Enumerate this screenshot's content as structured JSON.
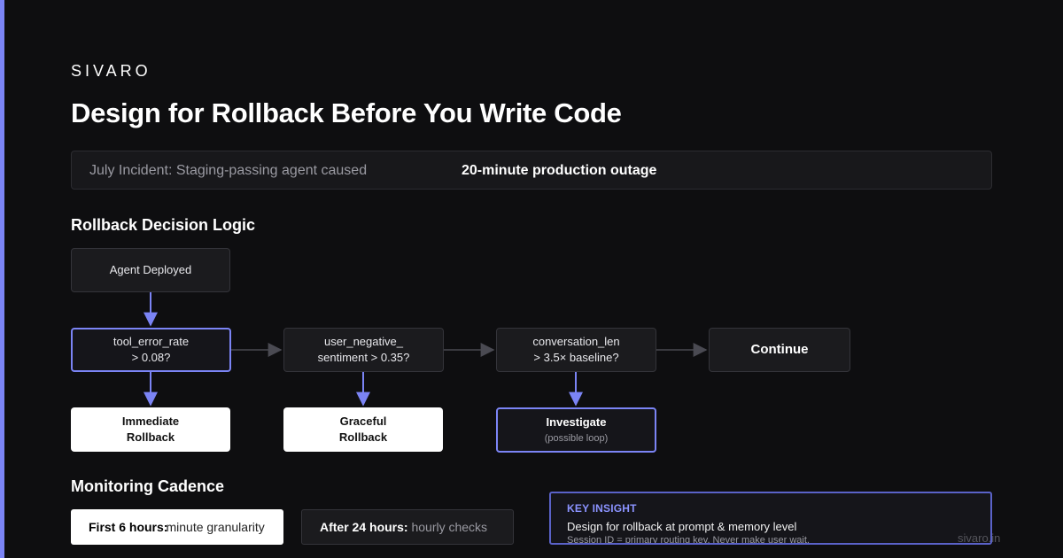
{
  "brand": "SIVARO",
  "title": "Design for Rollback Before You Write Code",
  "incident": {
    "lead": "July Incident: Staging-passing agent caused",
    "stat": "20-minute production outage"
  },
  "decision": {
    "heading": "Rollback Decision Logic",
    "start": "Agent Deployed",
    "checks": [
      {
        "line1": "tool_error_rate",
        "line2": "> 0.08?"
      },
      {
        "line1": "user_negative_",
        "line2": "sentiment > 0.35?"
      },
      {
        "line1": "conversation_len",
        "line2": "> 3.5× baseline?"
      }
    ],
    "continue": "Continue",
    "outcomes": [
      {
        "line1": "Immediate",
        "line2": "Rollback"
      },
      {
        "line1": "Graceful",
        "line2": "Rollback"
      },
      {
        "line1": "Investigate",
        "line2": "(possible loop)"
      }
    ]
  },
  "monitoring": {
    "heading": "Monitoring Cadence",
    "items": [
      {
        "bold": "First 6 hours:",
        "text": "minute granularity"
      },
      {
        "bold": "After 24 hours:",
        "text": "hourly checks"
      }
    ]
  },
  "insight": {
    "label": "KEY INSIGHT",
    "line1": "Design for rollback at prompt & memory level",
    "line2": "Session ID = primary routing key. Never make user wait."
  },
  "footer": "sivaro.in",
  "colors": {
    "accent": "#7b84f5",
    "background": "#0e0e10",
    "connector": "#3a3a40"
  }
}
